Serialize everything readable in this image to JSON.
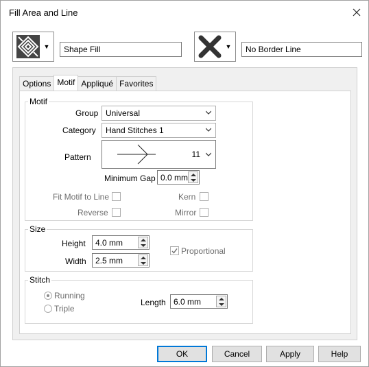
{
  "window": {
    "title": "Fill Area and Line"
  },
  "fill": {
    "value": "Shape Fill"
  },
  "border": {
    "value": "No Border Line"
  },
  "tabs": [
    {
      "label": "Options"
    },
    {
      "label": "Motif"
    },
    {
      "label": "Appliqué"
    },
    {
      "label": "Favorites"
    }
  ],
  "motif": {
    "group_title": "Motif",
    "group_label": "Group",
    "group_value": "Universal",
    "category_label": "Category",
    "category_value": "Hand Stitches 1",
    "pattern_label": "Pattern",
    "pattern_number": "11",
    "min_gap_label": "Minimum Gap",
    "min_gap_value": "0.0 mm",
    "fit_label": "Fit Motif to Line",
    "kern_label": "Kern",
    "reverse_label": "Reverse",
    "mirror_label": "Mirror"
  },
  "size": {
    "group_title": "Size",
    "height_label": "Height",
    "height_value": "4.0 mm",
    "width_label": "Width",
    "width_value": "2.5 mm",
    "proportional_label": "Proportional",
    "proportional_checked": true
  },
  "stitch": {
    "group_title": "Stitch",
    "running_label": "Running",
    "triple_label": "Triple",
    "selected": "Running",
    "length_label": "Length",
    "length_value": "6.0 mm"
  },
  "buttons": {
    "ok": "OK",
    "cancel": "Cancel",
    "apply": "Apply",
    "help": "Help"
  },
  "icons": {
    "close": "close-icon",
    "fill": "fill-pattern-icon",
    "border": "no-border-icon"
  }
}
